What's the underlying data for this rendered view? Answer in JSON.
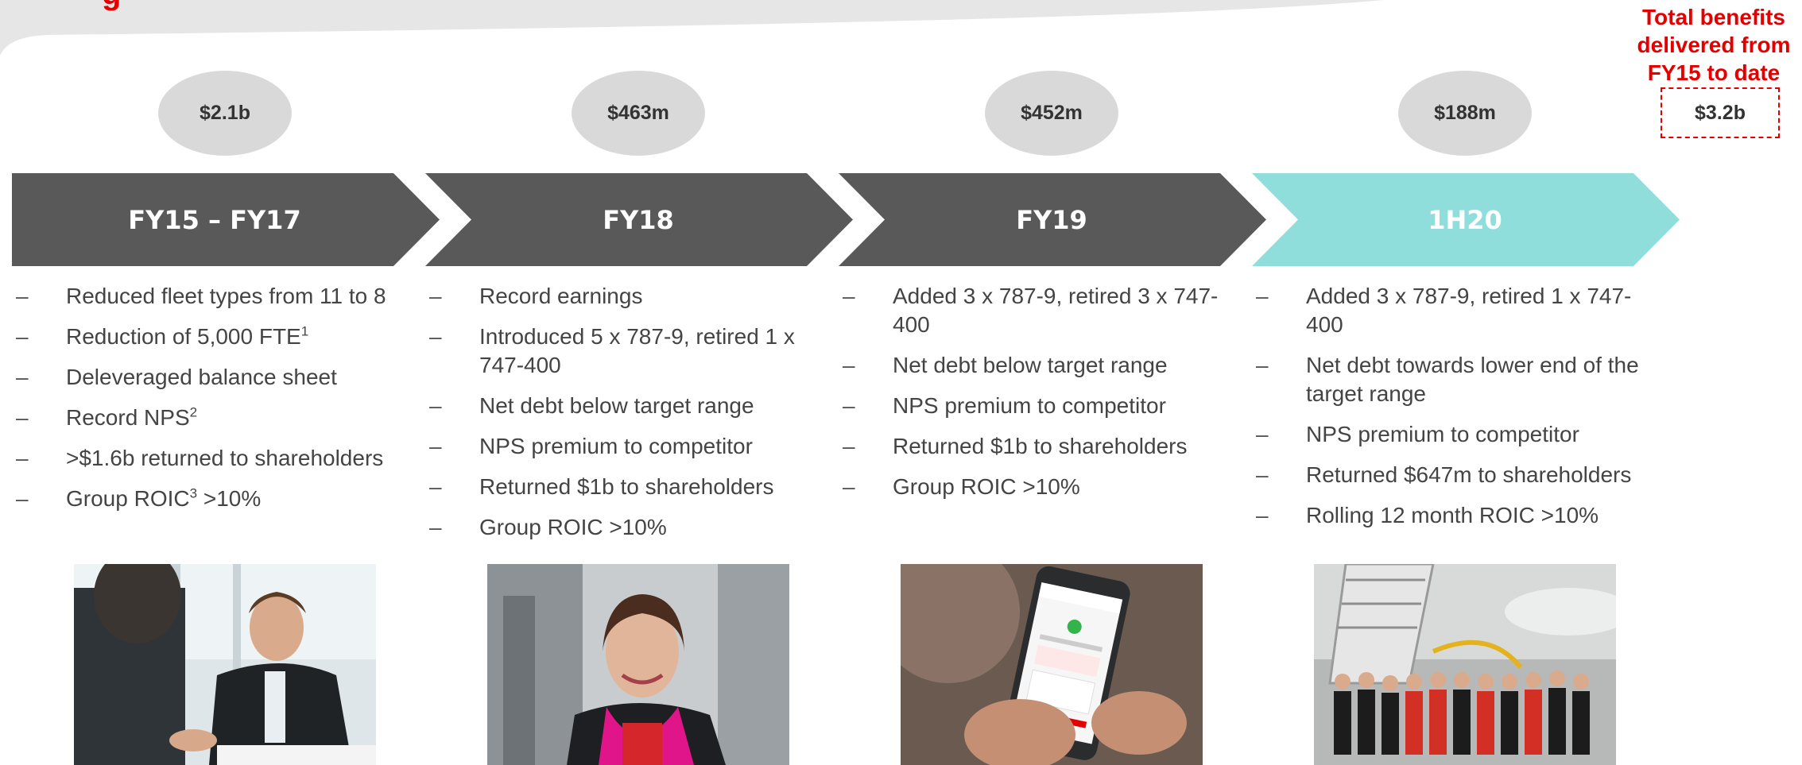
{
  "title_fragment": "g",
  "total": {
    "title": "Total benefits delivered from FY15 to date",
    "title_lines": [
      "Total benefits",
      "delivered from",
      "FY15 to date"
    ],
    "value": "$3.2b"
  },
  "periods": [
    {
      "label": "FY15 – FY17",
      "benefit": "$2.1b",
      "items": [
        {
          "text": "Reduced fleet types from 11 to 8"
        },
        {
          "text": "Reduction of 5,000 FTE",
          "sup": "1"
        },
        {
          "text": "Deleveraged balance sheet"
        },
        {
          "text": "Record NPS",
          "sup": "2"
        },
        {
          "text": ">$1.6b returned to shareholders"
        },
        {
          "text": "Group ROIC",
          "sup": "3",
          "after": " >10%"
        }
      ]
    },
    {
      "label": "FY18",
      "benefit": "$463m",
      "items": [
        {
          "text": "Record earnings"
        },
        {
          "text": "Introduced 5 x 787-9, retired 1 x 747-400"
        },
        {
          "text": "Net debt below target range"
        },
        {
          "text": "NPS premium to competitor"
        },
        {
          "text": "Returned $1b to shareholders"
        },
        {
          "text": "Group ROIC >10%"
        }
      ]
    },
    {
      "label": "FY19",
      "benefit": "$452m",
      "items": [
        {
          "text": "Added 3 x 787-9, retired 3 x 747-400"
        },
        {
          "text": "Net debt below target range"
        },
        {
          "text": "NPS premium to competitor"
        },
        {
          "text": "Returned $1b to shareholders"
        },
        {
          "text": "Group ROIC >10%"
        }
      ]
    },
    {
      "label": "1H20",
      "benefit": "$188m",
      "items": [
        {
          "text": "Added 3 x 787-9, retired 1 x 747-400"
        },
        {
          "text": "Net debt towards lower end of the target range"
        },
        {
          "text": "NPS premium to competitor"
        },
        {
          "text": "Returned $647m to shareholders"
        },
        {
          "text": "Rolling 12 month ROIC >10%"
        }
      ]
    }
  ],
  "bullet_symbol": "–",
  "colors": {
    "accent_red": "#e40000",
    "chevron_dark": "#595959",
    "chevron_current": "#8fdedb",
    "bubble_grey": "#d9d9d9",
    "top_band": "#e6e6e6"
  },
  "photos": [
    "business-meeting-photo",
    "flight-attendant-photo",
    "mobile-app-photo",
    "crew-group-photo"
  ]
}
